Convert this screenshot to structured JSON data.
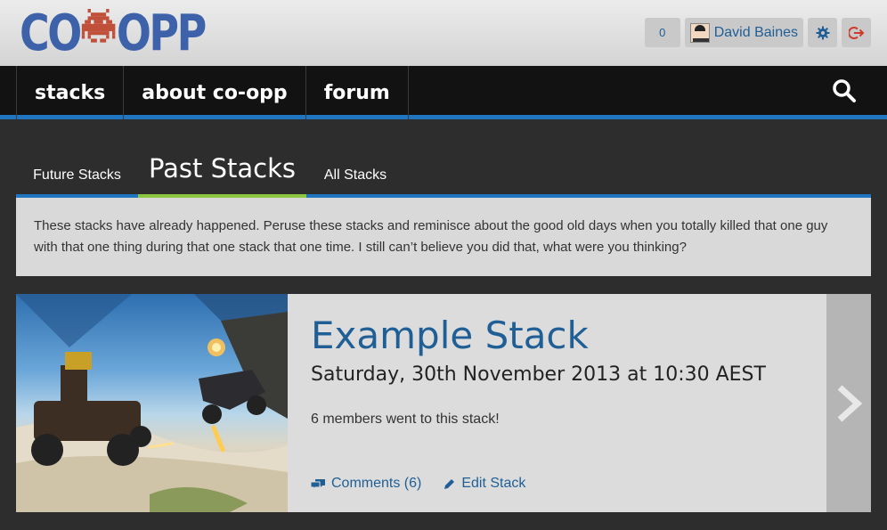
{
  "header": {
    "logo_left": "CO",
    "logo_right": "OPP",
    "notifications_count": "0",
    "user_name": "David Baines",
    "icons": {
      "settings": "gear-icon",
      "logout": "logout-icon"
    },
    "colors": {
      "logo": "#3d62aa",
      "logo_invader": "#c0503a",
      "link": "#1f5f96"
    }
  },
  "nav": {
    "items": [
      {
        "label": "stacks"
      },
      {
        "label": "about co-opp"
      },
      {
        "label": "forum"
      }
    ],
    "search_icon": "search-icon",
    "accent": "#1f75c0"
  },
  "tabs": [
    {
      "label": "Future Stacks",
      "active": false
    },
    {
      "label": "Past Stacks",
      "active": true
    },
    {
      "label": "All Stacks",
      "active": false
    }
  ],
  "description": "These stacks have already happened. Peruse these stacks and reminisce about the good old days when you totally killed that one guy with that one thing during that one stack that one time. I still can’t believe you did that, what were you thinking?",
  "stack": {
    "title": "Example Stack",
    "datetime": "Saturday, 30th November 2013 at 10:30 AEST",
    "members_text": "6 members went to this stack!",
    "comments_label": "Comments (6)",
    "edit_label": "Edit Stack",
    "next_icon": "chevron-right-icon"
  }
}
